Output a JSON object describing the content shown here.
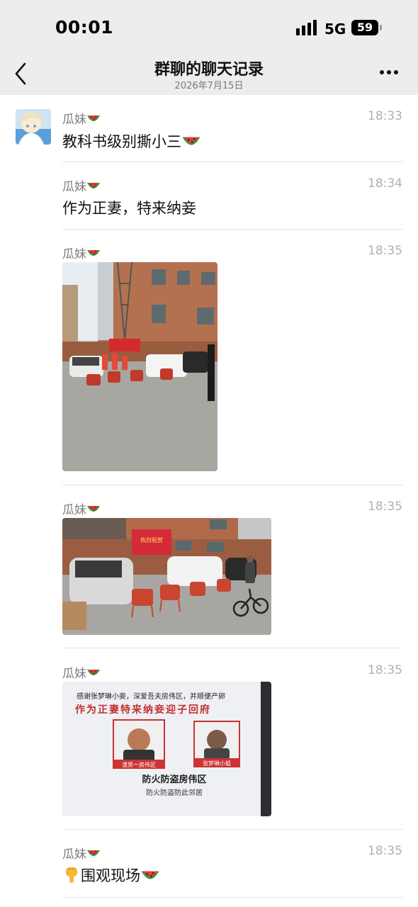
{
  "status_bar": {
    "time": "00:01",
    "network": "5G",
    "battery": "59"
  },
  "header": {
    "title": "群聊的聊天记录",
    "subtitle": "2026年7月15日"
  },
  "messages": [
    {
      "sender": "瓜妹",
      "time": "18:33",
      "text": "教科书级别撕小三"
    },
    {
      "sender": "瓜妹",
      "time": "18:34",
      "text": "作为正妻，特来纳妾"
    },
    {
      "sender": "瓜妹",
      "time": "18:35",
      "image": "street-gathering-photo"
    },
    {
      "sender": "瓜妹",
      "time": "18:35",
      "image": "drums-and-banner-photo"
    },
    {
      "sender": "瓜妹",
      "time": "18:35",
      "image": "notice-flyer-photo"
    },
    {
      "sender": "瓜妹",
      "time": "18:35",
      "text": "围观现场",
      "text_prefix_icon": "pointing-down-emoji"
    }
  ],
  "flyer": {
    "line1": "感谢张梦琳小妾，深爱吾夫房伟区，并顺便产卵",
    "line2": "作为正妻特来纳妾迎子回府",
    "caption_left": "渣男一房伟区",
    "caption_right": "张梦琳小姐",
    "heading": "防火防盗房伟区",
    "subheading": "防火防盗防此邻居"
  },
  "banner_text": "热烈祝贺",
  "icons": {
    "sender_suffix": "watermelon-emoji",
    "back": "chevron-left-icon",
    "more": "more-dots-icon"
  },
  "colors": {
    "header_bg": "#ededed",
    "divider": "#e3e3e3",
    "time": "#b0b0b0",
    "sender": "#7a7a7a"
  }
}
